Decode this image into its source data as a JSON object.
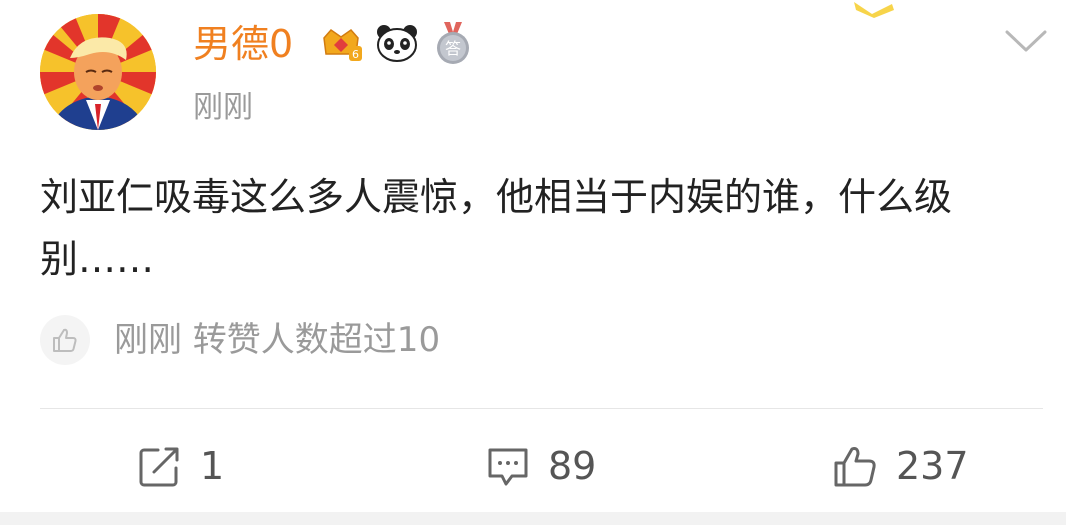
{
  "post": {
    "username": "男德0",
    "time": "刚刚",
    "content": "刘亚仁吸毒这么多人震惊，他相当于内娱的谁，什么级别……",
    "like_note": "刚刚 转赞人数超过10",
    "badges": [
      {
        "icon": "crown-level-icon",
        "text": "6"
      },
      {
        "icon": "panda-icon"
      },
      {
        "icon": "answer-medal-icon",
        "text": "答"
      }
    ]
  },
  "actions": {
    "repost_count": "1",
    "comment_count": "89",
    "like_count": "237"
  },
  "colors": {
    "username": "#f08020",
    "meta": "#9a9a9a",
    "body_text": "#222222"
  }
}
